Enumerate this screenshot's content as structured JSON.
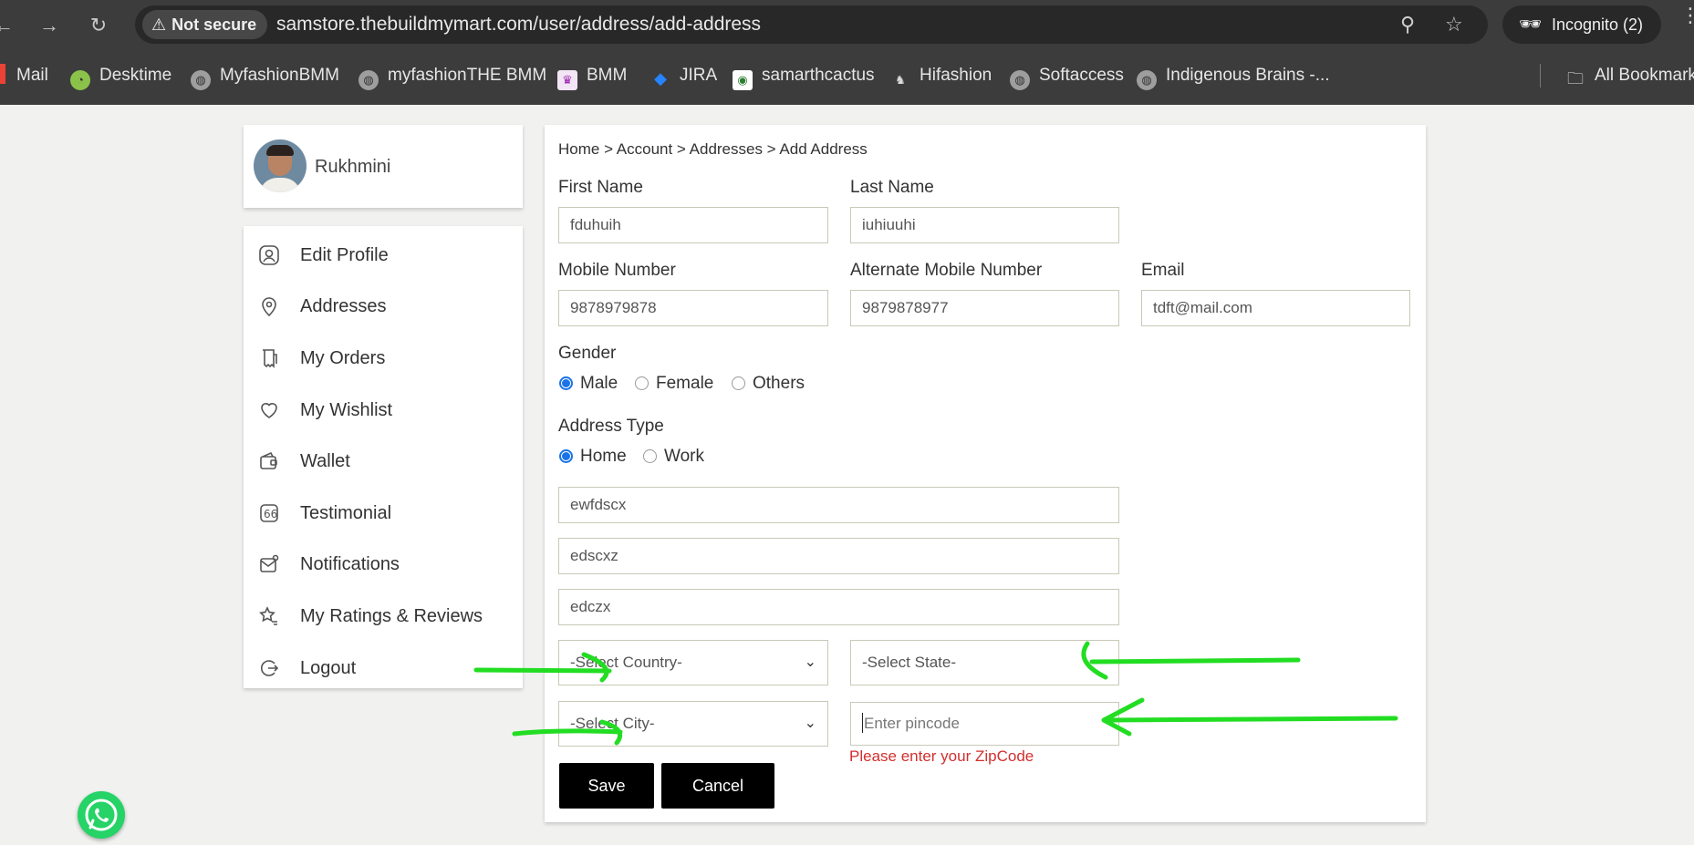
{
  "browser": {
    "security_label": "Not secure",
    "url": "samstore.thebuildmymart.com/user/address/add-address",
    "incognito_label": "Incognito (2)",
    "bookmarks": [
      {
        "label": "Mail",
        "icon": "gmail-icon"
      },
      {
        "label": "Desktime",
        "icon": "desktime-icon"
      },
      {
        "label": "MyfashionBMM",
        "icon": "globe-icon"
      },
      {
        "label": "myfashionTHE BMM",
        "icon": "globe-icon"
      },
      {
        "label": "BMM",
        "icon": "bmm-icon"
      },
      {
        "label": "JIRA",
        "icon": "jira-icon"
      },
      {
        "label": "samarthcactus",
        "icon": "cactus-icon"
      },
      {
        "label": "Hifashion",
        "icon": "hifashion-icon"
      },
      {
        "label": "Softaccess",
        "icon": "globe-icon"
      },
      {
        "label": "Indigenous Brains -...",
        "icon": "globe-icon"
      }
    ],
    "all_bookmarks_label": "All Bookmarks"
  },
  "sidebar": {
    "user_name": "Rukhmini",
    "items": [
      {
        "label": "Edit Profile",
        "icon": "user-icon"
      },
      {
        "label": "Addresses",
        "icon": "location-pin-icon"
      },
      {
        "label": "My Orders",
        "icon": "receipt-icon"
      },
      {
        "label": "My Wishlist",
        "icon": "heart-icon"
      },
      {
        "label": "Wallet",
        "icon": "wallet-icon"
      },
      {
        "label": "Testimonial",
        "icon": "quote-icon"
      },
      {
        "label": "Notifications",
        "icon": "mail-notification-icon"
      },
      {
        "label": "My Ratings & Reviews",
        "icon": "star-rating-icon"
      },
      {
        "label": "Logout",
        "icon": "logout-icon"
      }
    ]
  },
  "form": {
    "breadcrumb": "Home > Account > Addresses > Add Address",
    "first_name": {
      "label": "First Name",
      "value": "fduhuih"
    },
    "last_name": {
      "label": "Last Name",
      "value": "iuhiuuhi"
    },
    "mobile": {
      "label": "Mobile Number",
      "value": "9878979878"
    },
    "alt_mobile": {
      "label": "Alternate Mobile Number",
      "value": "9879878977"
    },
    "email": {
      "label": "Email",
      "value": "tdft@mail.com"
    },
    "gender": {
      "label": "Gender",
      "options": [
        "Male",
        "Female",
        "Others"
      ],
      "selected": "Male"
    },
    "address_type": {
      "label": "Address Type",
      "options": [
        "Home",
        "Work"
      ],
      "selected": "Home"
    },
    "address_line1": "ewfdscx",
    "address_line2": "edscxz",
    "address_line3": "edczx",
    "country": "-Select Country-",
    "state": "-Select State-",
    "city": "-Select City-",
    "pincode_placeholder": "Enter pincode",
    "pincode_error": "Please enter your ZipCode",
    "save_label": "Save",
    "cancel_label": "Cancel"
  },
  "colors": {
    "annotation": "#22dd22",
    "accent": "#1a73e8",
    "error": "#d32f2f"
  }
}
